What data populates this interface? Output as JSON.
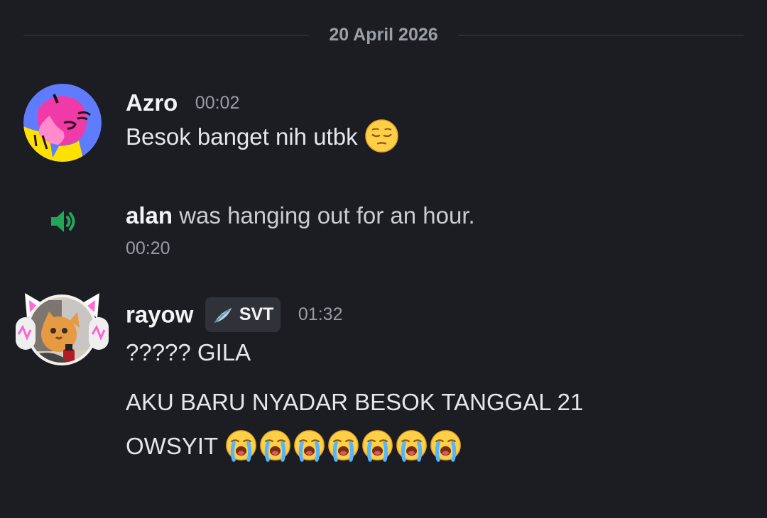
{
  "date_divider": "20 April 2026",
  "messages": [
    {
      "author": "Azro",
      "time": "00:02",
      "text": "Besok banget nih utbk",
      "emoji": [
        "pensive-face-emoji"
      ]
    },
    {
      "author": "rayow",
      "tag": "SVT",
      "tag_icon": "feather-icon",
      "time": "01:32",
      "lines": [
        "????? GILA",
        "AKU BARU NYADAR BESOK TANGGAL 21",
        "OWSYIT"
      ],
      "emoji": [
        "loudly-crying-face-emoji",
        "loudly-crying-face-emoji",
        "loudly-crying-face-emoji",
        "loudly-crying-face-emoji",
        "loudly-crying-face-emoji",
        "loudly-crying-face-emoji",
        "loudly-crying-face-emoji"
      ]
    }
  ],
  "system_message": {
    "user": "alan",
    "text": "was hanging out for an hour.",
    "time": "00:20",
    "icon": "speaker-icon",
    "icon_color": "#23a55a"
  },
  "colors": {
    "background": "#1c1d22",
    "username": "#f2f3f5",
    "timestamp": "#979ca5",
    "divider": "#3c3f46"
  }
}
